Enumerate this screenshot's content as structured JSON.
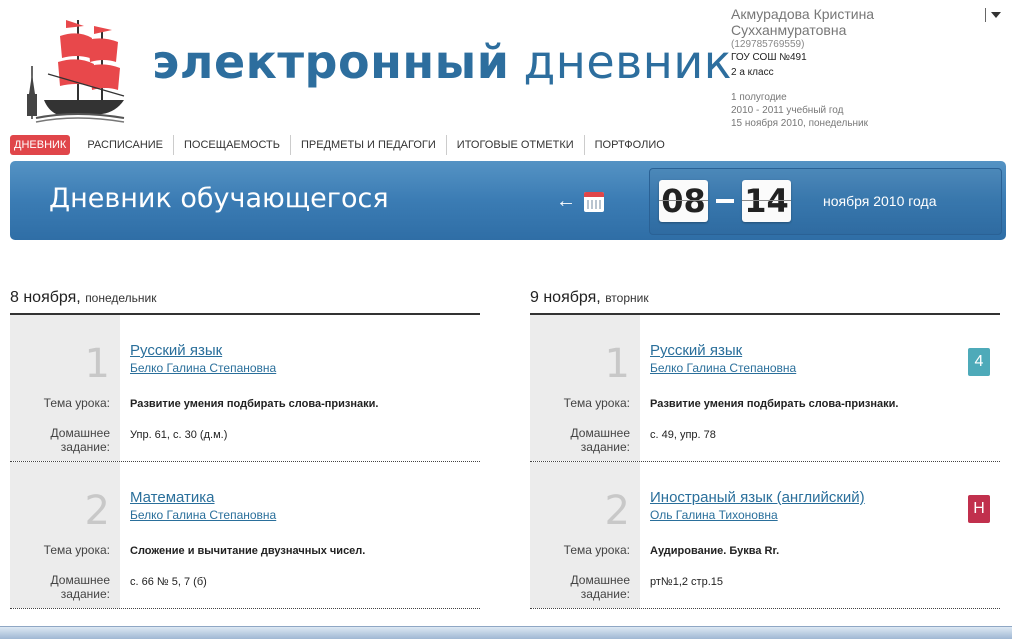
{
  "header": {
    "title_bold": "электронный",
    "title_regular": "дневник"
  },
  "user": {
    "name": "Акмурадова Кристина Сухханмуратовна",
    "phone": "(129785769559)",
    "school": "ГОУ СОШ №491",
    "class": "2 а класс",
    "semester": "1 полугодие",
    "year": "2010 - 2011 учебный год",
    "date": "15 ноября 2010, понедельник"
  },
  "nav": {
    "items": [
      "ДНЕВНИК",
      "РАСПИСАНИЕ",
      "ПОСЕЩАЕМОСТЬ",
      "ПРЕДМЕТЫ И ПЕДАГОГИ",
      "ИТОГОВЫЕ ОТМЕТКИ",
      "ПОРТФОЛИО"
    ]
  },
  "banner": {
    "title": "Дневник обучающегося",
    "date_from": "08",
    "date_to": "14",
    "month_year": "ноября 2010 года"
  },
  "days": [
    {
      "date": "8 ноября,",
      "weekday": "понедельник",
      "lessons": [
        {
          "num": "1",
          "subject": "Русский язык",
          "teacher": "Белко Галина Степановна",
          "topic_label": "Тема урока:",
          "topic": "Развитие умения подбирать слова-признаки.",
          "hw_label": "Домашнее задание:",
          "hw": "Упр. 61, с. 30 (д.м.)",
          "mark": ""
        },
        {
          "num": "2",
          "subject": "Математика",
          "teacher": "Белко Галина Степановна",
          "topic_label": "Тема урока:",
          "topic": "Сложение и вычитание двузначных чисел.",
          "hw_label": "Домашнее задание:",
          "hw": "с. 66 № 5, 7 (б)",
          "mark": ""
        }
      ]
    },
    {
      "date": "9 ноября,",
      "weekday": "вторник",
      "lessons": [
        {
          "num": "1",
          "subject": "Русский язык",
          "teacher": "Белко Галина Степановна",
          "topic_label": "Тема урока:",
          "topic": "Развитие умения подбирать слова-признаки.",
          "hw_label": "Домашнее задание:",
          "hw": "с. 49, упр. 78",
          "mark": "4"
        },
        {
          "num": "2",
          "subject": "Иностраный язык (английский)",
          "teacher": "Оль Галина Тихоновна",
          "topic_label": "Тема урока:",
          "topic": "Аудирование. Буква Rr.",
          "hw_label": "Домашнее задание:",
          "hw": "рт№1,2 стр.15",
          "mark": "Н"
        }
      ]
    }
  ]
}
